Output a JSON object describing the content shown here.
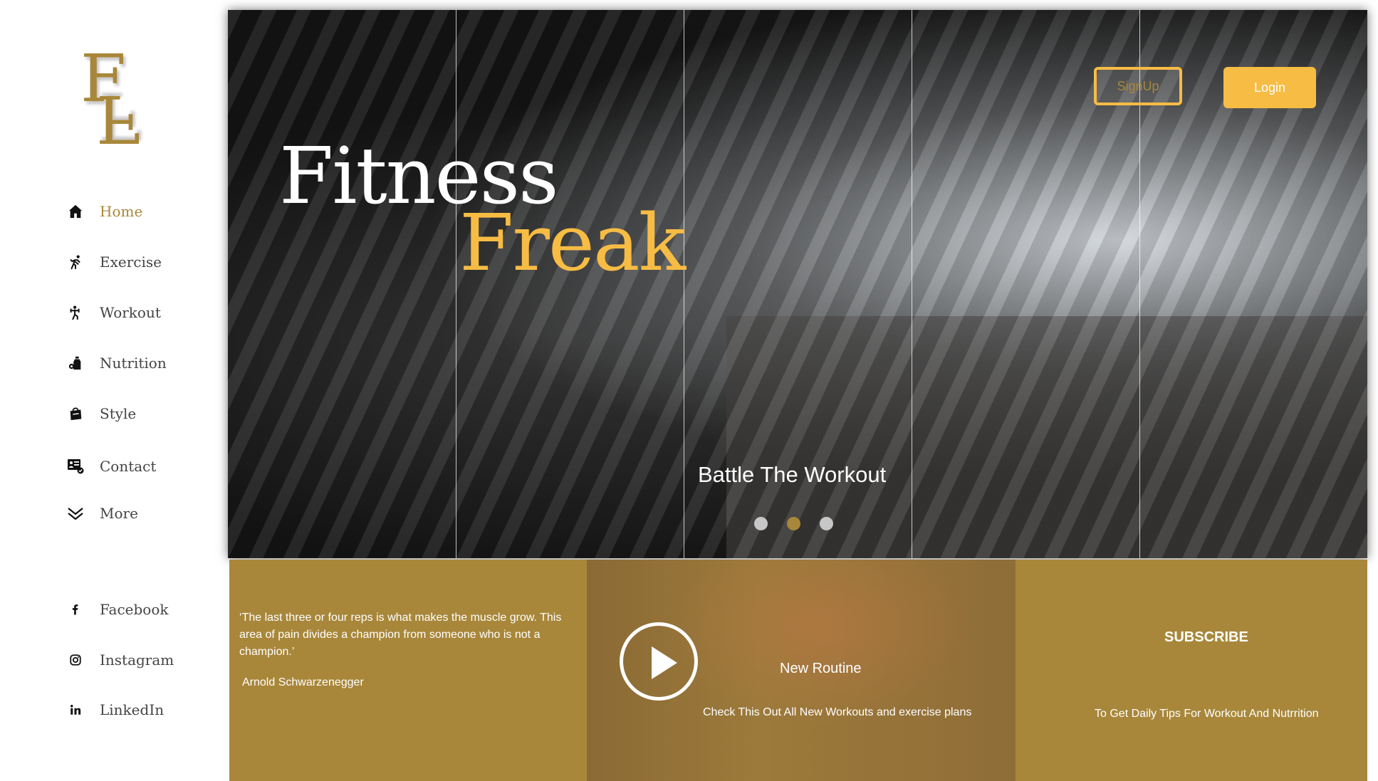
{
  "logo": {
    "line1": "F",
    "line2": "F"
  },
  "nav": {
    "items": [
      {
        "label": "Home",
        "icon": "home-icon",
        "active": true
      },
      {
        "label": "Exercise",
        "icon": "running-icon"
      },
      {
        "label": "Workout",
        "icon": "workout-icon"
      },
      {
        "label": "Nutrition",
        "icon": "bottle-icon"
      },
      {
        "label": "Style",
        "icon": "shopping-bag-icon"
      },
      {
        "label": "Contact",
        "icon": "contact-card-icon"
      },
      {
        "label": "More",
        "icon": "chevron-down-icon"
      }
    ],
    "social": [
      {
        "label": "Facebook",
        "icon": "facebook-icon"
      },
      {
        "label": "Instagram",
        "icon": "instagram-icon"
      },
      {
        "label": "LinkedIn",
        "icon": "linkedin-icon"
      }
    ]
  },
  "hero": {
    "title_line1": "Fitness",
    "title_line2": "Freak",
    "tagline": "Battle The Workout",
    "signup_label": "SignUp",
    "login_label": "Login",
    "carousel_active_index": 1
  },
  "panels": {
    "quote": {
      "text": "‘The last three or four reps is what makes the muscle grow. This area of pain divides a champion from someone who is not a champion.’",
      "author": "Arnold Schwarzenegger"
    },
    "video": {
      "title": "New Routine",
      "description": "Check This Out All New Workouts and exercise plans"
    },
    "subscribe": {
      "title": "SUBSCRIBE",
      "description": "To Get Daily Tips For Workout And Nutrrition"
    }
  },
  "colors": {
    "gold": "#a8873a",
    "accent": "#f7bc44",
    "text": "#444444"
  }
}
